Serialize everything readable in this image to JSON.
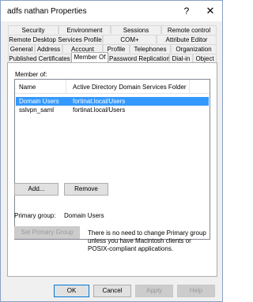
{
  "window": {
    "title": "adfs nathan Properties",
    "help_glyph": "?",
    "close_glyph": "✕"
  },
  "tabs": {
    "row1": [
      "Security",
      "Environment",
      "Sessions",
      "Remote control"
    ],
    "row2": [
      "Remote Desktop Services Profile",
      "COM+",
      "Attribute Editor"
    ],
    "row3": [
      "General",
      "Address",
      "Account",
      "Profile",
      "Telephones",
      "Organization"
    ],
    "row4": [
      "Published Certificates",
      "Member Of",
      "Password Replication",
      "Dial-in",
      "Object"
    ],
    "active": "Member Of"
  },
  "member_of": {
    "label": "Member of:",
    "columns": [
      "Name",
      "Active Directory Domain Services Folder"
    ],
    "rows": [
      {
        "name": "Domain Users",
        "folder": "fortinat.local/Users",
        "selected": true
      },
      {
        "name": "sslvpn_saml",
        "folder": "fortinat.local/Users",
        "selected": false
      }
    ]
  },
  "buttons": {
    "add": "Add...",
    "remove": "Remove",
    "set_primary": "Set Primary Group",
    "ok": "OK",
    "cancel": "Cancel",
    "apply": "Apply",
    "help": "Help"
  },
  "primary_group": {
    "label": "Primary group:",
    "value": "Domain Users",
    "note": "There is no need to change Primary group unless you have Macintosh clients or POSIX-compliant applications."
  },
  "colors": {
    "selection": "#3399ff",
    "default_button_border": "#0078d7"
  }
}
